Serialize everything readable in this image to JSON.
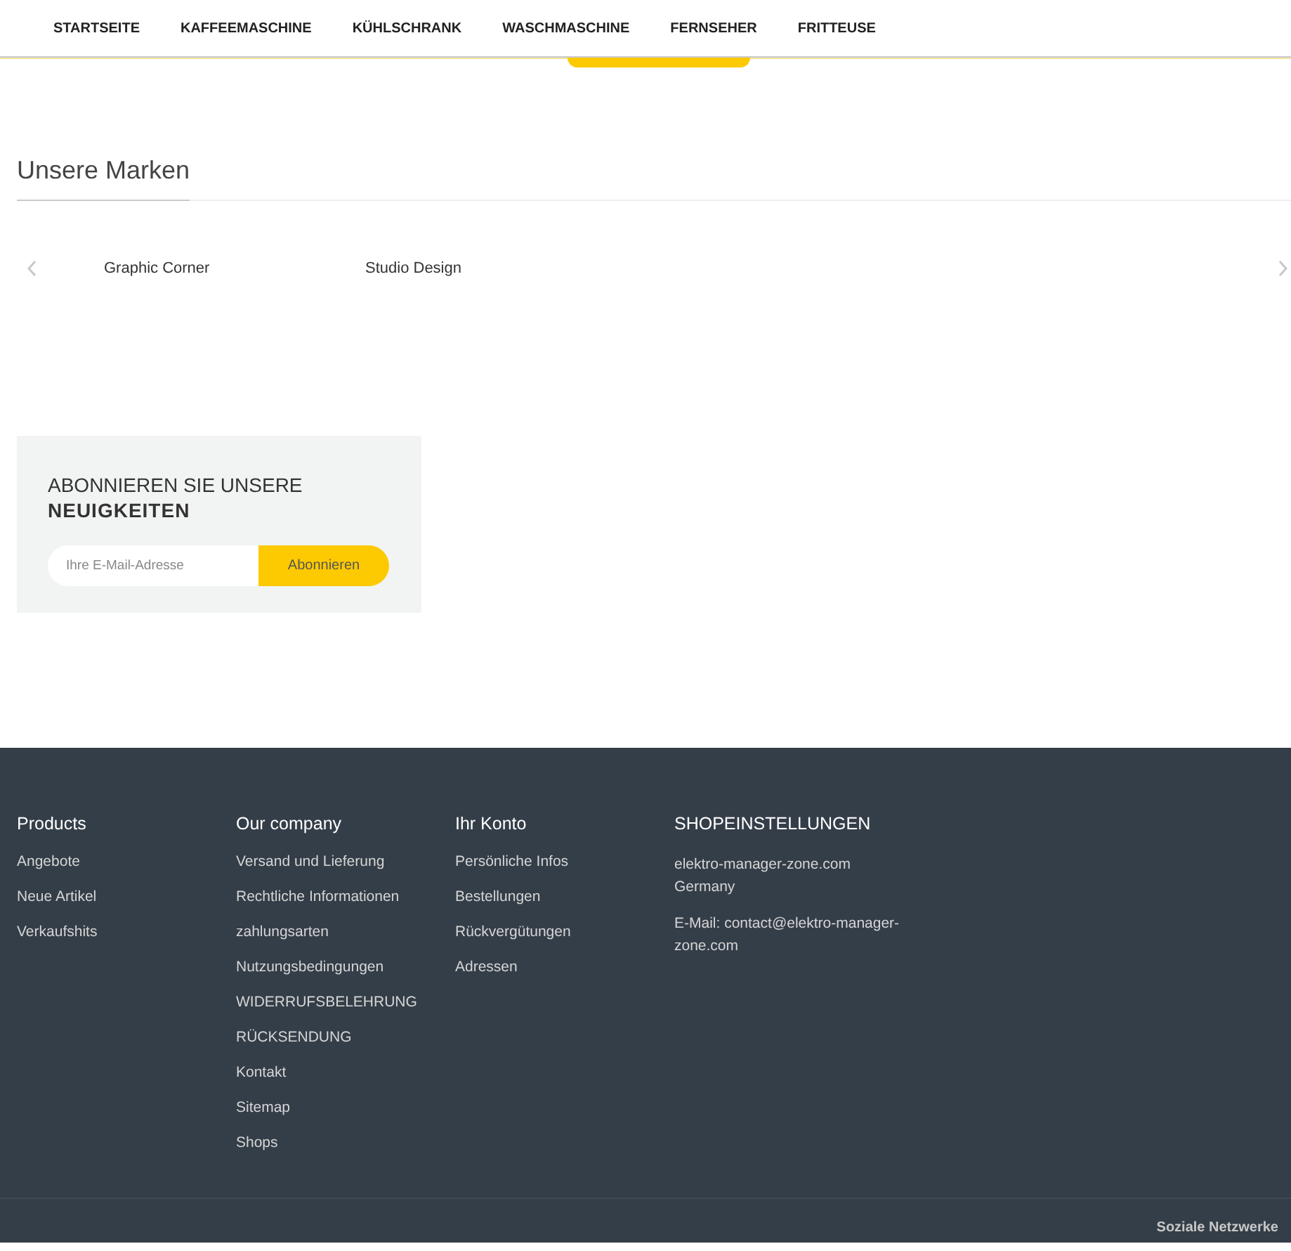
{
  "nav": {
    "items": [
      {
        "label": "STARTSEITE"
      },
      {
        "label": "KAFFEEMASCHINE"
      },
      {
        "label": "KÜHLSCHRANK"
      },
      {
        "label": "WASCHMASCHINE"
      },
      {
        "label": "FERNSEHER"
      },
      {
        "label": "FRITTEUSE"
      }
    ]
  },
  "brands": {
    "title": "Unsere Marken",
    "items": [
      "Graphic Corner",
      "Studio Design"
    ]
  },
  "newsletter": {
    "title": "ABONNIEREN SIE UNSERE",
    "title_bold": "NEUIGKEITEN",
    "placeholder": "Ihre E-Mail-Adresse",
    "button": "Abonnieren"
  },
  "footer": {
    "columns": [
      {
        "title": "Products",
        "links": [
          "Angebote",
          "Neue Artikel",
          "Verkaufshits"
        ]
      },
      {
        "title": "Our company",
        "links": [
          "Versand und Lieferung",
          "Rechtliche Informationen",
          "zahlungsarten",
          "Nutzungsbedingungen",
          "WIDERRUFSBELEHRUNG",
          "RÜCKSENDUNG",
          "Kontakt",
          "Sitemap",
          "Shops"
        ]
      },
      {
        "title": "Ihr Konto",
        "links": [
          "Persönliche Infos",
          "Bestellungen",
          "Rückvergütungen",
          "Adressen"
        ]
      }
    ],
    "store": {
      "title": "SHOPEINSTELLUNGEN",
      "address": [
        "elektro-manager-zone.com",
        "Germany"
      ],
      "email": "E-Mail: contact@elektro-manager-zone.com"
    },
    "social_title": "Soziale Netzwerke"
  }
}
